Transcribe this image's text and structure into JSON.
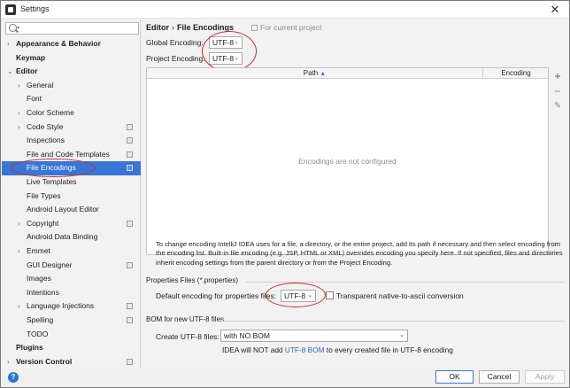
{
  "window": {
    "title": "Settings",
    "close_glyph": "✕"
  },
  "search": {
    "placeholder": "",
    "icon": "search-icon",
    "caret": "▾"
  },
  "tree": [
    {
      "label": "Appearance & Behavior",
      "arrow": "›",
      "bold": true,
      "indent": 0,
      "project": false
    },
    {
      "label": "Keymap",
      "arrow": "",
      "bold": true,
      "indent": 0,
      "project": false
    },
    {
      "label": "Editor",
      "arrow": "⌄",
      "bold": true,
      "indent": 0,
      "project": false
    },
    {
      "label": "General",
      "arrow": "›",
      "bold": false,
      "indent": 1,
      "project": false
    },
    {
      "label": "Font",
      "arrow": "",
      "bold": false,
      "indent": 1,
      "project": false
    },
    {
      "label": "Color Scheme",
      "arrow": "›",
      "bold": false,
      "indent": 1,
      "project": false
    },
    {
      "label": "Code Style",
      "arrow": "›",
      "bold": false,
      "indent": 1,
      "project": true
    },
    {
      "label": "Inspections",
      "arrow": "",
      "bold": false,
      "indent": 1,
      "project": true
    },
    {
      "label": "File and Code Templates",
      "arrow": "",
      "bold": false,
      "indent": 1,
      "project": true
    },
    {
      "label": "File Encodings",
      "arrow": "",
      "bold": false,
      "indent": 1,
      "project": true,
      "selected": true
    },
    {
      "label": "Live Templates",
      "arrow": "",
      "bold": false,
      "indent": 1,
      "project": false
    },
    {
      "label": "File Types",
      "arrow": "",
      "bold": false,
      "indent": 1,
      "project": false
    },
    {
      "label": "Android Layout Editor",
      "arrow": "",
      "bold": false,
      "indent": 1,
      "project": false
    },
    {
      "label": "Copyright",
      "arrow": "›",
      "bold": false,
      "indent": 1,
      "project": true
    },
    {
      "label": "Android Data Binding",
      "arrow": "",
      "bold": false,
      "indent": 1,
      "project": false
    },
    {
      "label": "Emmet",
      "arrow": "›",
      "bold": false,
      "indent": 1,
      "project": false
    },
    {
      "label": "GUI Designer",
      "arrow": "",
      "bold": false,
      "indent": 1,
      "project": true
    },
    {
      "label": "Images",
      "arrow": "",
      "bold": false,
      "indent": 1,
      "project": false
    },
    {
      "label": "Intentions",
      "arrow": "",
      "bold": false,
      "indent": 1,
      "project": false
    },
    {
      "label": "Language Injections",
      "arrow": "›",
      "bold": false,
      "indent": 1,
      "project": true
    },
    {
      "label": "Spelling",
      "arrow": "",
      "bold": false,
      "indent": 1,
      "project": true
    },
    {
      "label": "TODO",
      "arrow": "",
      "bold": false,
      "indent": 1,
      "project": false
    },
    {
      "label": "Plugins",
      "arrow": "",
      "bold": true,
      "indent": 0,
      "project": false
    },
    {
      "label": "Version Control",
      "arrow": "›",
      "bold": true,
      "indent": 0,
      "project": true
    }
  ],
  "breadcrumb": {
    "parent": "Editor",
    "separator": "›",
    "current": "File Encodings"
  },
  "scope_note": "For current project",
  "encodings": {
    "global_label": "Global Encoding:",
    "global_value": "UTF-8",
    "project_label": "Project Encoding:",
    "project_value": "UTF-8",
    "chevron": "⌄"
  },
  "table": {
    "col_path": "Path",
    "sort_glyph": "▲",
    "col_encoding": "Encoding",
    "empty": "Encodings are not configured"
  },
  "tools": {
    "add": "+",
    "remove": "−",
    "edit": "✎"
  },
  "description": "To change encoding IntelliJ IDEA uses for a file, a directory, or the entire project, add its path if necessary and then select encoding from the encoding list. Built-in file encoding (e.g. JSP, HTML or XML) overrides encoding you specify here. If not specified, files and directories inherit encoding settings from the parent directory or from the Project Encoding.",
  "properties": {
    "section": "Properties Files (*.properties)",
    "default_label": "Default encoding for properties files:",
    "value": "UTF-8",
    "transparent_label": "Transparent native-to-ascii conversion",
    "transparent_checked": false
  },
  "bom": {
    "section": "BOM for new UTF-8 files",
    "create_label": "Create UTF-8 files:",
    "value": "with NO BOM",
    "hint_before": "IDEA will NOT add ",
    "hint_link": "UTF-8 BOM",
    "hint_after": " to every created file in UTF-8 encoding"
  },
  "buttons": {
    "ok": "OK",
    "cancel": "Cancel",
    "apply": "Apply"
  },
  "help_glyph": "?",
  "colors": {
    "selection": "#3875d6",
    "annotation": "#d42a2a",
    "link": "#2b6bc2"
  }
}
